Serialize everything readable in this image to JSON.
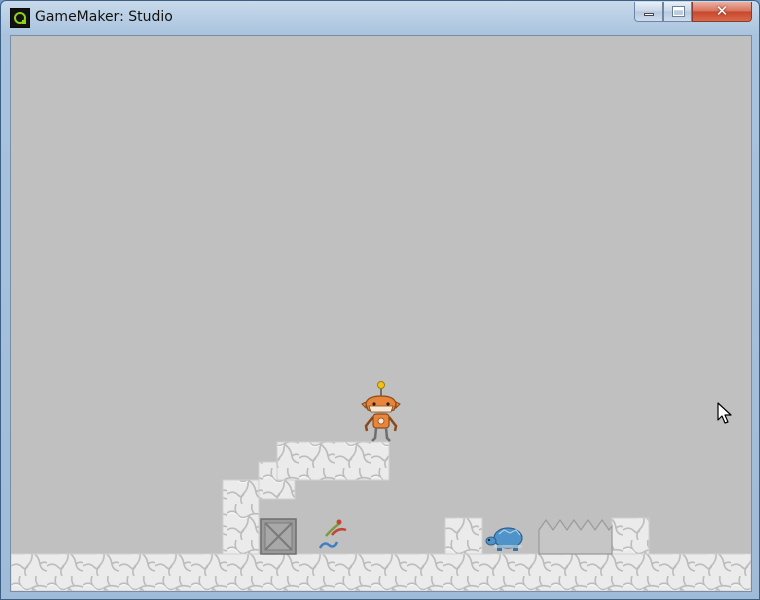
{
  "window": {
    "title": "GameMaker: Studio",
    "close_glyph": "✕"
  },
  "colors": {
    "room_background": "#c0c0c0",
    "stone_fill": "#e9e9e9",
    "stone_crack": "#bdbdbd",
    "robot_orange": "#e9853a",
    "turtle_blue": "#4f93c8"
  },
  "icons": [
    "gamemaker-logo-icon",
    "minimize-icon",
    "maximize-icon",
    "close-icon",
    "mouse-pointer-icon"
  ],
  "scene": {
    "sprites": [
      "player-robot",
      "crate",
      "spring-powerup",
      "blue-turtle-enemy",
      "spike-trap"
    ]
  }
}
